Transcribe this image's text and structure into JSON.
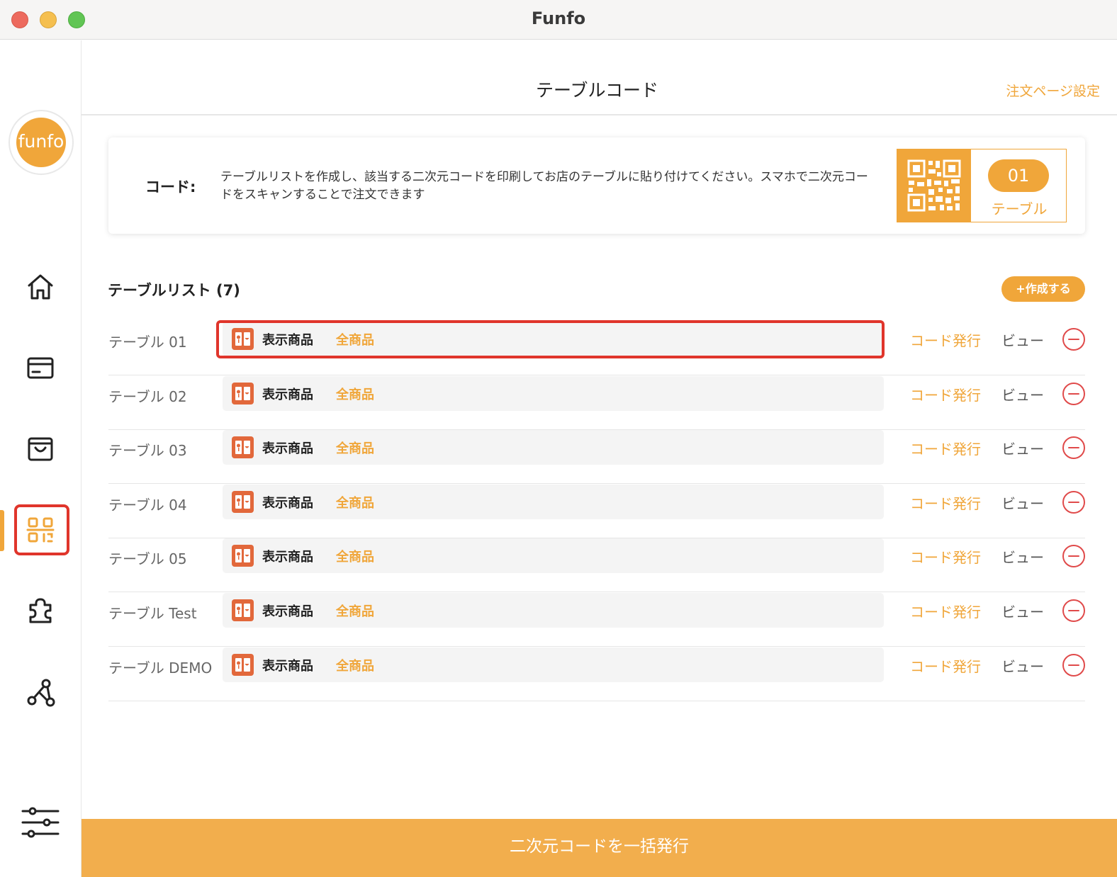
{
  "window": {
    "title": "Funfo"
  },
  "sidebar": {
    "logo_text": "funfo",
    "items": [
      {
        "name": "home",
        "icon": "home-icon"
      },
      {
        "name": "orders",
        "icon": "card-icon"
      },
      {
        "name": "products",
        "icon": "shopping-bag-icon"
      },
      {
        "name": "table-code",
        "icon": "qr-code-icon",
        "active": true
      },
      {
        "name": "plugins",
        "icon": "puzzle-icon"
      },
      {
        "name": "share",
        "icon": "share-nodes-icon"
      },
      {
        "name": "settings",
        "icon": "sliders-icon"
      }
    ]
  },
  "header": {
    "title": "テーブルコード",
    "order_page_settings": "注文ページ設定"
  },
  "info_card": {
    "label": "コード:",
    "description": "テーブルリストを作成し、該当する二次元コードを印刷してお店のテーブルに貼り付けてください。スマホで二次元コードをスキャンすることで注文できます",
    "qr_number": "01",
    "qr_caption": "テーブル"
  },
  "table_list": {
    "title": "テーブルリスト (7)",
    "create_label": "+作成する",
    "rows": [
      {
        "name": "テーブル 01",
        "field_label": "表示商品",
        "field_value": "全商品",
        "issue_label": "コード発行",
        "view_label": "ビュー"
      },
      {
        "name": "テーブル 02",
        "field_label": "表示商品",
        "field_value": "全商品",
        "issue_label": "コード発行",
        "view_label": "ビュー"
      },
      {
        "name": "テーブル 03",
        "field_label": "表示商品",
        "field_value": "全商品",
        "issue_label": "コード発行",
        "view_label": "ビュー"
      },
      {
        "name": "テーブル 04",
        "field_label": "表示商品",
        "field_value": "全商品",
        "issue_label": "コード発行",
        "view_label": "ビュー"
      },
      {
        "name": "テーブル 05",
        "field_label": "表示商品",
        "field_value": "全商品",
        "issue_label": "コード発行",
        "view_label": "ビュー"
      },
      {
        "name": "テーブル Test",
        "field_label": "表示商品",
        "field_value": "全商品",
        "issue_label": "コード発行",
        "view_label": "ビュー"
      },
      {
        "name": "テーブル DEMO",
        "field_label": "表示商品",
        "field_value": "全商品",
        "issue_label": "コード発行",
        "view_label": "ビュー"
      }
    ]
  },
  "footer": {
    "bulk_issue_label": "二次元コードを一括発行"
  },
  "colors": {
    "accent": "#f0a63a",
    "highlight": "#e0352b",
    "delete": "#e04a4a",
    "menu_icon": "#e2683b"
  }
}
